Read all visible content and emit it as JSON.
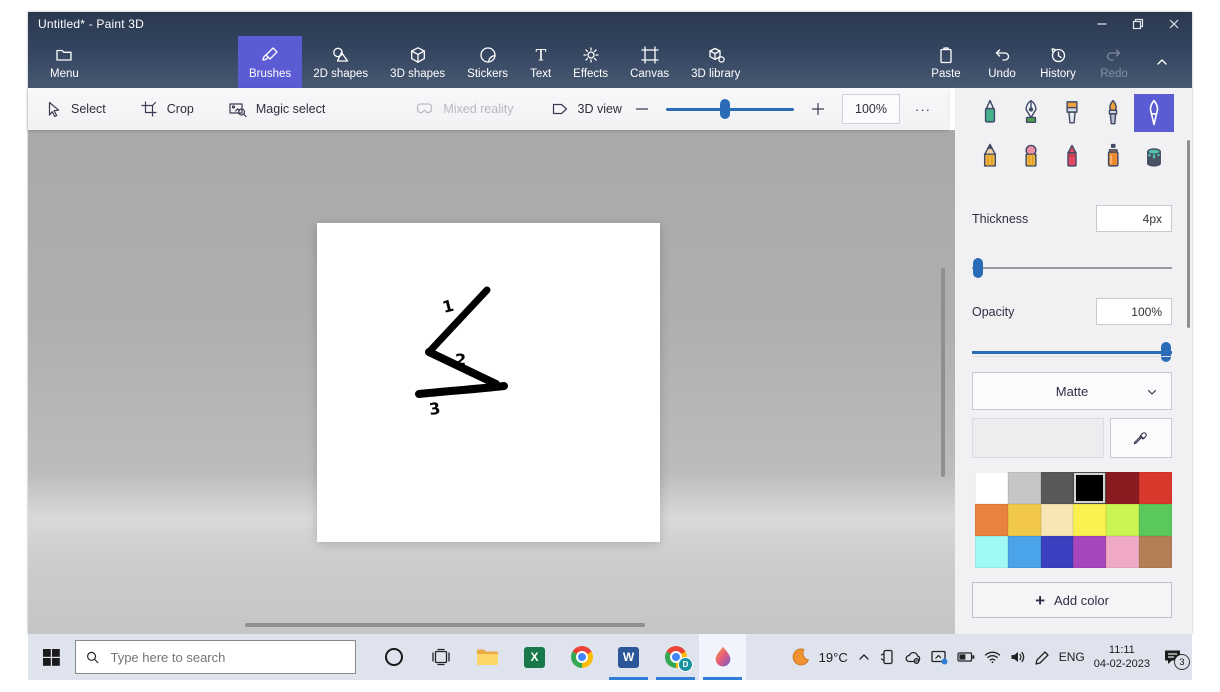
{
  "window": {
    "title": "Untitled* - Paint 3D"
  },
  "ribbon": {
    "menu": "Menu",
    "tabs": [
      {
        "label": "Brushes",
        "icon": "brush-icon",
        "selected": true
      },
      {
        "label": "2D shapes",
        "icon": "2d-shapes-icon"
      },
      {
        "label": "3D shapes",
        "icon": "3d-shapes-icon"
      },
      {
        "label": "Stickers",
        "icon": "stickers-icon"
      },
      {
        "label": "Text",
        "icon": "text-icon"
      },
      {
        "label": "Effects",
        "icon": "effects-icon"
      },
      {
        "label": "Canvas",
        "icon": "canvas-icon"
      },
      {
        "label": "3D library",
        "icon": "3d-library-icon"
      }
    ],
    "actions": [
      {
        "label": "Paste",
        "icon": "paste-icon"
      },
      {
        "label": "Undo",
        "icon": "undo-icon"
      },
      {
        "label": "History",
        "icon": "history-icon"
      },
      {
        "label": "Redo",
        "icon": "redo-icon",
        "disabled": true
      }
    ]
  },
  "toolbar": {
    "select": "Select",
    "crop": "Crop",
    "magic_select": "Magic select",
    "mixed_reality": "Mixed reality",
    "view_3d": "3D view",
    "zoom_value": "100%",
    "zoom_thumb_left": "46%",
    "more": "···"
  },
  "sidebar": {
    "tools": [
      "marker",
      "calligraphy-pen",
      "oil-brush",
      "watercolor",
      "pixel-pen",
      "pencil",
      "eraser",
      "crayon",
      "spray-can",
      "fill"
    ],
    "selected_tool": "pixel-pen",
    "thickness": {
      "label": "Thickness",
      "value": "4px",
      "thumb_left": "3%"
    },
    "opacity": {
      "label": "Opacity",
      "value": "100%",
      "thumb_left": "97%"
    },
    "material": {
      "value": "Matte"
    },
    "palette": [
      "#ffffff",
      "#c6c6c6",
      "#595959",
      "#000000",
      "#8a1c21",
      "#d8392c",
      "#e8823e",
      "#f2c84b",
      "#f5e6b3",
      "#faf151",
      "#c9f553",
      "#5bc85b",
      "#9ff8f3",
      "#4ba4ea",
      "#3b3fc0",
      "#a847bb",
      "#f1aac5",
      "#b37e55"
    ],
    "selected_color_index": 3,
    "add_color": {
      "plus": "+",
      "label": "Add color"
    }
  },
  "canvas_doodle": {
    "labels": {
      "one": "1",
      "two": "2",
      "three": "3"
    }
  },
  "taskbar": {
    "search": {
      "placeholder": "Type here to search"
    },
    "apps": [
      "cortana",
      "task-view",
      "file-explorer",
      "excel",
      "chrome",
      "word",
      "chrome-profile",
      "paint-3d"
    ],
    "tray": {
      "temperature": "19°C",
      "language": "ENG",
      "time": "11:11",
      "date": "04-02-2023",
      "notifications": "3"
    }
  },
  "colors": {
    "accent": "#5b5bd4",
    "slider_blue": "#2a6cb5",
    "taskbar_underline": "#2f7fd6"
  }
}
